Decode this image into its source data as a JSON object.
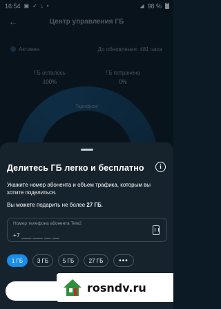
{
  "status_bar": {
    "time": "16:54",
    "battery": "98 %",
    "icons": [
      "screen-record-icon",
      "vpn-icon",
      "download-icon",
      "dot-icon",
      "signal-icon",
      "battery-icon"
    ]
  },
  "background": {
    "title": "Центр управления ГБ",
    "active_label": "Активен",
    "update_label": "До обновления: 481 часа",
    "gb_left_label": "ГБ осталось",
    "gb_left_value": "100%",
    "gb_spent_label": "ГБ потрачено",
    "gb_spent_value": "0%",
    "gauge_label": "Тарифное"
  },
  "sheet": {
    "title": "Делитесь ГБ легко и бесплатно",
    "description": "Укажите номер абонента и объем трафика, которым вы хотите поделиться.",
    "limit_prefix": "Вы можете подарить не более ",
    "limit_value": "27 ГБ",
    "limit_suffix": ".",
    "phone_label": "Номер телефона абонента Tele2",
    "phone_value": "+7 ___ ___ __ __",
    "chips": [
      "1 ГБ",
      "3 ГБ",
      "5 ГБ",
      "27 ГБ"
    ],
    "more_label": "•••",
    "selected_chip": "1 ГБ"
  },
  "watermark": {
    "text": "rosndv.ru"
  },
  "colors": {
    "accent": "#1b8ce8",
    "sheet_bg": "#16232d",
    "screen_bg": "#0d1b26"
  }
}
